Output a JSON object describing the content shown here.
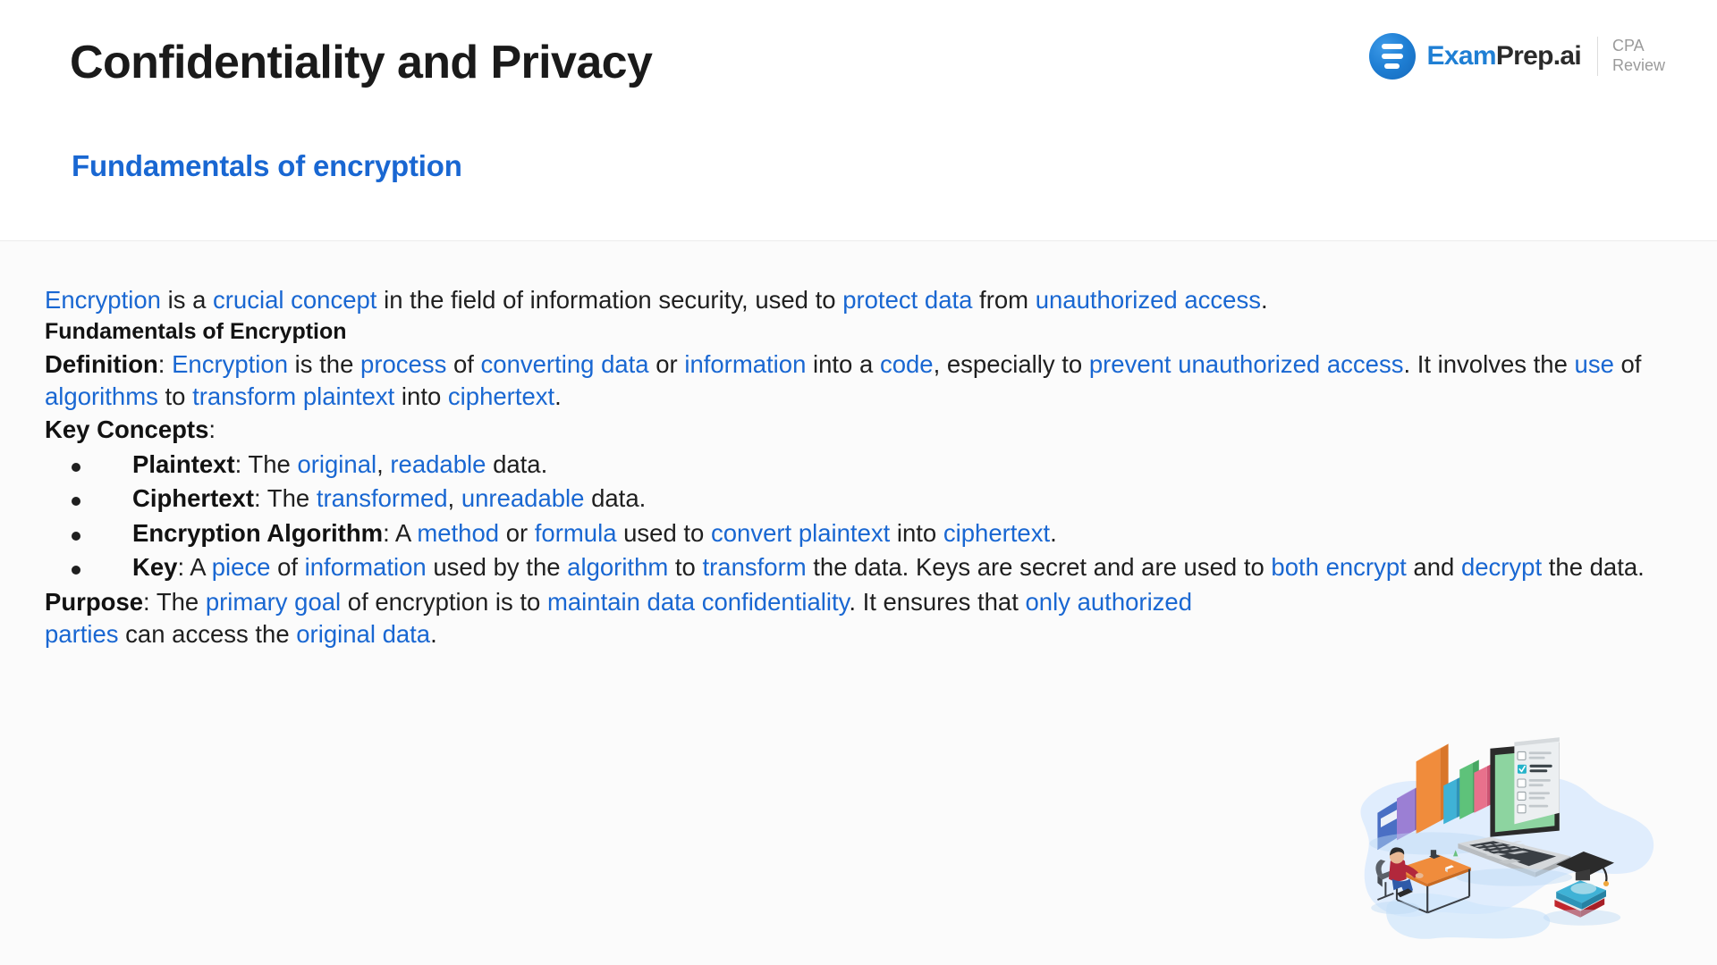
{
  "header": {
    "title": "Confidentiality and Privacy",
    "subtitle": "Fundamentals of encryption",
    "logo": {
      "icon_name": "examprep-bars-icon",
      "word_first": "Exam",
      "word_second": "Prep.ai",
      "sub_line1": "CPA",
      "sub_line2": "Review"
    }
  },
  "colors": {
    "accent_blue": "#1967d2",
    "logo_blue": "#1f7fd4",
    "text_dark": "#1f1f1f",
    "body_background": "#fbfbfb",
    "header_background": "#ffffff",
    "sub_gray": "#9b9b9b"
  },
  "body": {
    "intro": {
      "segments": [
        {
          "text": "Encryption",
          "style": "link"
        },
        {
          "text": " is a ",
          "style": "plain"
        },
        {
          "text": "crucial concept",
          "style": "link"
        },
        {
          "text": " in the field of information security, used to ",
          "style": "plain"
        },
        {
          "text": "protect data",
          "style": "link"
        },
        {
          "text": " from ",
          "style": "plain"
        },
        {
          "text": "unauthorized access",
          "style": "link"
        },
        {
          "text": ".",
          "style": "plain"
        }
      ]
    },
    "section_heading": "Fundamentals of Encryption",
    "definition": {
      "label": "Definition",
      "segments": [
        {
          "text": "Definition",
          "style": "bold"
        },
        {
          "text": ": ",
          "style": "plain"
        },
        {
          "text": "Encryption",
          "style": "link"
        },
        {
          "text": " is the ",
          "style": "plain"
        },
        {
          "text": "process",
          "style": "link"
        },
        {
          "text": " of ",
          "style": "plain"
        },
        {
          "text": "converting data",
          "style": "link"
        },
        {
          "text": " or ",
          "style": "plain"
        },
        {
          "text": "information",
          "style": "link"
        },
        {
          "text": " into a ",
          "style": "plain"
        },
        {
          "text": "code",
          "style": "link"
        },
        {
          "text": ", especially to ",
          "style": "plain"
        },
        {
          "text": "prevent unauthorized access",
          "style": "link"
        },
        {
          "text": ". It involves the ",
          "style": "plain"
        },
        {
          "text": "use",
          "style": "link"
        },
        {
          "text": " of ",
          "style": "plain"
        },
        {
          "text": "algorithms",
          "style": "link"
        },
        {
          "text": " to ",
          "style": "plain"
        },
        {
          "text": "transform plaintext",
          "style": "link"
        },
        {
          "text": " into ",
          "style": "plain"
        },
        {
          "text": "ciphertext",
          "style": "link"
        },
        {
          "text": ".",
          "style": "plain"
        }
      ]
    },
    "key_concepts_label": "Key Concepts",
    "key_concepts": [
      {
        "term": "Plaintext",
        "segments": [
          {
            "text": "Plaintext",
            "style": "bold"
          },
          {
            "text": ": The ",
            "style": "plain"
          },
          {
            "text": "original",
            "style": "link"
          },
          {
            "text": ", ",
            "style": "plain"
          },
          {
            "text": "readable",
            "style": "link"
          },
          {
            "text": " data.",
            "style": "plain"
          }
        ]
      },
      {
        "term": "Ciphertext",
        "segments": [
          {
            "text": "Ciphertext",
            "style": "bold"
          },
          {
            "text": ": The ",
            "style": "plain"
          },
          {
            "text": "transformed",
            "style": "link"
          },
          {
            "text": ", ",
            "style": "plain"
          },
          {
            "text": "unreadable",
            "style": "link"
          },
          {
            "text": " data.",
            "style": "plain"
          }
        ]
      },
      {
        "term": "Encryption Algorithm",
        "segments": [
          {
            "text": "Encryption Algorithm",
            "style": "bold"
          },
          {
            "text": ": A ",
            "style": "plain"
          },
          {
            "text": "method",
            "style": "link"
          },
          {
            "text": " or ",
            "style": "plain"
          },
          {
            "text": "formula",
            "style": "link"
          },
          {
            "text": " used to ",
            "style": "plain"
          },
          {
            "text": "convert plaintext",
            "style": "link"
          },
          {
            "text": " into ",
            "style": "plain"
          },
          {
            "text": "ciphertext",
            "style": "link"
          },
          {
            "text": ".",
            "style": "plain"
          }
        ]
      },
      {
        "term": "Key",
        "segments": [
          {
            "text": "Key",
            "style": "bold"
          },
          {
            "text": ": A ",
            "style": "plain"
          },
          {
            "text": "piece",
            "style": "link"
          },
          {
            "text": " of ",
            "style": "plain"
          },
          {
            "text": "information",
            "style": "link"
          },
          {
            "text": " used by the ",
            "style": "plain"
          },
          {
            "text": "algorithm",
            "style": "link"
          },
          {
            "text": " to ",
            "style": "plain"
          },
          {
            "text": "transform",
            "style": "link"
          },
          {
            "text": " the data. Keys are secret and are used to ",
            "style": "plain"
          },
          {
            "text": "both encrypt",
            "style": "link"
          },
          {
            "text": " and ",
            "style": "plain"
          },
          {
            "text": "decrypt",
            "style": "link"
          },
          {
            "text": " the data.",
            "style": "plain"
          }
        ]
      }
    ],
    "purpose": {
      "label": "Purpose",
      "segments": [
        {
          "text": "Purpose",
          "style": "bold"
        },
        {
          "text": ": The ",
          "style": "plain"
        },
        {
          "text": "primary goal",
          "style": "link"
        },
        {
          "text": " of encryption is to ",
          "style": "plain"
        },
        {
          "text": "maintain data confidentiality",
          "style": "link"
        },
        {
          "text": ". It ensures that ",
          "style": "plain"
        },
        {
          "text": "only authorized parties",
          "style": "link"
        },
        {
          "text": " can access the ",
          "style": "plain"
        },
        {
          "text": "original data",
          "style": "link"
        },
        {
          "text": ".",
          "style": "plain"
        }
      ]
    }
  },
  "illustration": {
    "name": "isometric-online-study-illustration",
    "elements": [
      "books",
      "laptop-with-checklist",
      "person-at-desk",
      "graduation-cap",
      "stacked-books"
    ]
  }
}
